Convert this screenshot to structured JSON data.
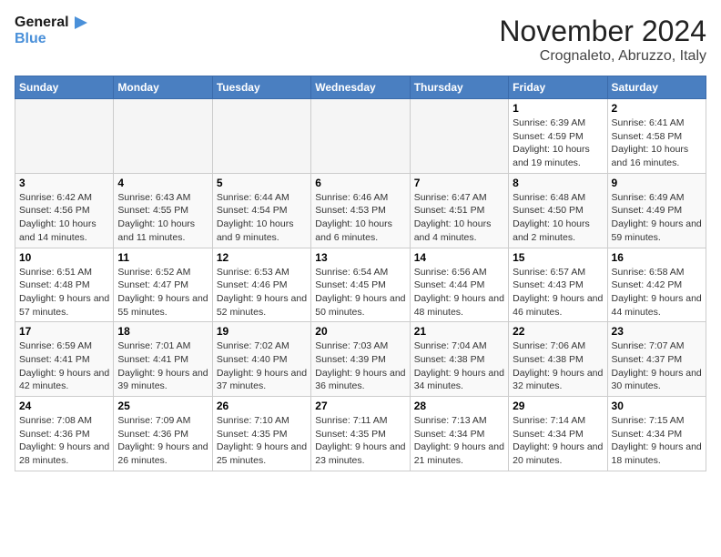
{
  "header": {
    "logo_line1": "General",
    "logo_line2": "Blue",
    "month": "November 2024",
    "location": "Crognaleto, Abruzzo, Italy"
  },
  "weekdays": [
    "Sunday",
    "Monday",
    "Tuesday",
    "Wednesday",
    "Thursday",
    "Friday",
    "Saturday"
  ],
  "weeks": [
    [
      {
        "day": "",
        "info": ""
      },
      {
        "day": "",
        "info": ""
      },
      {
        "day": "",
        "info": ""
      },
      {
        "day": "",
        "info": ""
      },
      {
        "day": "",
        "info": ""
      },
      {
        "day": "1",
        "info": "Sunrise: 6:39 AM\nSunset: 4:59 PM\nDaylight: 10 hours and 19 minutes."
      },
      {
        "day": "2",
        "info": "Sunrise: 6:41 AM\nSunset: 4:58 PM\nDaylight: 10 hours and 16 minutes."
      }
    ],
    [
      {
        "day": "3",
        "info": "Sunrise: 6:42 AM\nSunset: 4:56 PM\nDaylight: 10 hours and 14 minutes."
      },
      {
        "day": "4",
        "info": "Sunrise: 6:43 AM\nSunset: 4:55 PM\nDaylight: 10 hours and 11 minutes."
      },
      {
        "day": "5",
        "info": "Sunrise: 6:44 AM\nSunset: 4:54 PM\nDaylight: 10 hours and 9 minutes."
      },
      {
        "day": "6",
        "info": "Sunrise: 6:46 AM\nSunset: 4:53 PM\nDaylight: 10 hours and 6 minutes."
      },
      {
        "day": "7",
        "info": "Sunrise: 6:47 AM\nSunset: 4:51 PM\nDaylight: 10 hours and 4 minutes."
      },
      {
        "day": "8",
        "info": "Sunrise: 6:48 AM\nSunset: 4:50 PM\nDaylight: 10 hours and 2 minutes."
      },
      {
        "day": "9",
        "info": "Sunrise: 6:49 AM\nSunset: 4:49 PM\nDaylight: 9 hours and 59 minutes."
      }
    ],
    [
      {
        "day": "10",
        "info": "Sunrise: 6:51 AM\nSunset: 4:48 PM\nDaylight: 9 hours and 57 minutes."
      },
      {
        "day": "11",
        "info": "Sunrise: 6:52 AM\nSunset: 4:47 PM\nDaylight: 9 hours and 55 minutes."
      },
      {
        "day": "12",
        "info": "Sunrise: 6:53 AM\nSunset: 4:46 PM\nDaylight: 9 hours and 52 minutes."
      },
      {
        "day": "13",
        "info": "Sunrise: 6:54 AM\nSunset: 4:45 PM\nDaylight: 9 hours and 50 minutes."
      },
      {
        "day": "14",
        "info": "Sunrise: 6:56 AM\nSunset: 4:44 PM\nDaylight: 9 hours and 48 minutes."
      },
      {
        "day": "15",
        "info": "Sunrise: 6:57 AM\nSunset: 4:43 PM\nDaylight: 9 hours and 46 minutes."
      },
      {
        "day": "16",
        "info": "Sunrise: 6:58 AM\nSunset: 4:42 PM\nDaylight: 9 hours and 44 minutes."
      }
    ],
    [
      {
        "day": "17",
        "info": "Sunrise: 6:59 AM\nSunset: 4:41 PM\nDaylight: 9 hours and 42 minutes."
      },
      {
        "day": "18",
        "info": "Sunrise: 7:01 AM\nSunset: 4:41 PM\nDaylight: 9 hours and 39 minutes."
      },
      {
        "day": "19",
        "info": "Sunrise: 7:02 AM\nSunset: 4:40 PM\nDaylight: 9 hours and 37 minutes."
      },
      {
        "day": "20",
        "info": "Sunrise: 7:03 AM\nSunset: 4:39 PM\nDaylight: 9 hours and 36 minutes."
      },
      {
        "day": "21",
        "info": "Sunrise: 7:04 AM\nSunset: 4:38 PM\nDaylight: 9 hours and 34 minutes."
      },
      {
        "day": "22",
        "info": "Sunrise: 7:06 AM\nSunset: 4:38 PM\nDaylight: 9 hours and 32 minutes."
      },
      {
        "day": "23",
        "info": "Sunrise: 7:07 AM\nSunset: 4:37 PM\nDaylight: 9 hours and 30 minutes."
      }
    ],
    [
      {
        "day": "24",
        "info": "Sunrise: 7:08 AM\nSunset: 4:36 PM\nDaylight: 9 hours and 28 minutes."
      },
      {
        "day": "25",
        "info": "Sunrise: 7:09 AM\nSunset: 4:36 PM\nDaylight: 9 hours and 26 minutes."
      },
      {
        "day": "26",
        "info": "Sunrise: 7:10 AM\nSunset: 4:35 PM\nDaylight: 9 hours and 25 minutes."
      },
      {
        "day": "27",
        "info": "Sunrise: 7:11 AM\nSunset: 4:35 PM\nDaylight: 9 hours and 23 minutes."
      },
      {
        "day": "28",
        "info": "Sunrise: 7:13 AM\nSunset: 4:34 PM\nDaylight: 9 hours and 21 minutes."
      },
      {
        "day": "29",
        "info": "Sunrise: 7:14 AM\nSunset: 4:34 PM\nDaylight: 9 hours and 20 minutes."
      },
      {
        "day": "30",
        "info": "Sunrise: 7:15 AM\nSunset: 4:34 PM\nDaylight: 9 hours and 18 minutes."
      }
    ]
  ]
}
